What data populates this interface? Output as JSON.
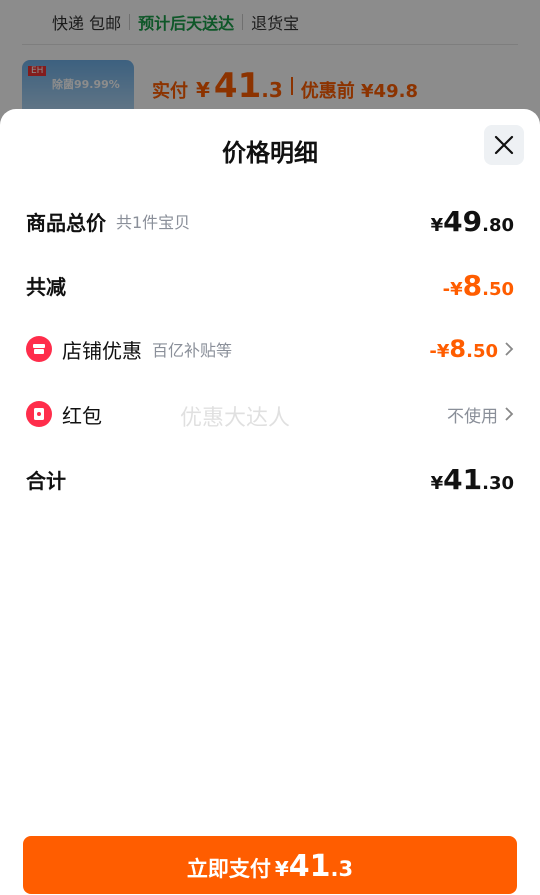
{
  "background": {
    "shipping": [
      "快递 包邮",
      "预计后天送达",
      "退货宝"
    ],
    "thumb_tag": "EH",
    "thumb_text": "除菌99.99%",
    "price_label": "实付",
    "currency": "¥",
    "price_int": "41",
    "price_dec": ".3",
    "before_label": "优惠前 ¥49.8"
  },
  "sheet": {
    "title": "价格明细",
    "rows": {
      "total_goods": {
        "label": "商品总价",
        "sub": "共1件宝贝",
        "yen": "¥",
        "int": "49",
        "dec": ".80"
      },
      "reduction": {
        "label": "共减",
        "prefix": "-¥",
        "int": "8",
        "dec": ".50"
      },
      "store_discount": {
        "label": "店铺优惠",
        "sub": "百亿补贴等",
        "prefix": "-¥",
        "int": "8",
        "dec": ".50"
      },
      "red_packet": {
        "label": "红包",
        "value": "不使用"
      },
      "sum": {
        "label": "合计",
        "yen": "¥",
        "int": "41",
        "dec": ".30"
      }
    },
    "watermark": "优惠大达人"
  },
  "pay_button": {
    "label": "立即支付",
    "yen": "¥",
    "int": "41",
    "dec": ".3"
  },
  "colors": {
    "accent": "#ff5d00",
    "green": "#1a9e4a",
    "red": "#ff2d4b"
  },
  "icons": [
    "close-icon",
    "store-icon",
    "red-packet-icon",
    "chevron-right-icon"
  ]
}
